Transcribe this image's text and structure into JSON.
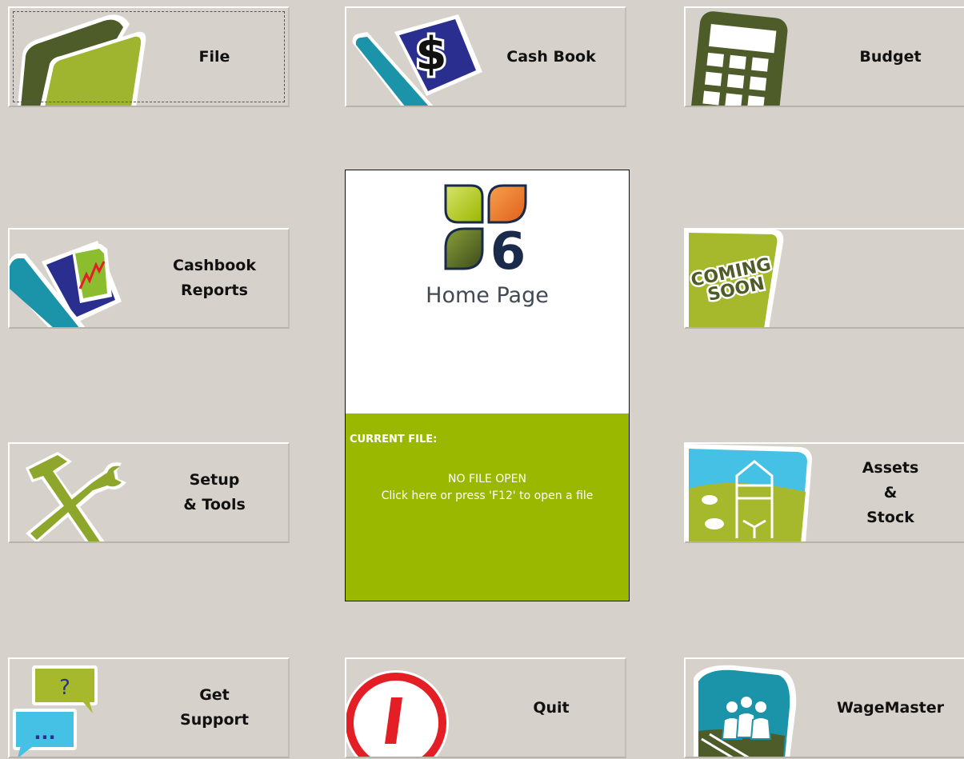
{
  "tiles": {
    "file": {
      "label": "File"
    },
    "cash_book": {
      "label": "Cash Book"
    },
    "budget": {
      "label": "Budget"
    },
    "cashbook_reports": {
      "label": "Cashbook\nReports"
    },
    "coming_soon": {
      "label": "",
      "badge_line1": "COMING",
      "badge_line2": "SOON"
    },
    "setup_tools": {
      "label": "Setup\n& Tools"
    },
    "assets_stock": {
      "label": "Assets\n&\nStock"
    },
    "get_support": {
      "label": "Get\nSupport"
    },
    "quit": {
      "label": "Quit"
    },
    "wagemaster": {
      "label": "WageMaster"
    }
  },
  "home_panel": {
    "logo_digit": "6",
    "title": "Home Page",
    "current_file_label": "CURRENT FILE:",
    "status_line1": "NO FILE OPEN",
    "status_line2": "Click here or press 'F12' to open a file"
  },
  "icons": {
    "file": "folder-icon",
    "cash_book": "cash-book-dollar-icon",
    "budget": "calculator-icon",
    "cashbook_reports": "report-chart-icon",
    "coming_soon": "coming-soon-icon",
    "setup_tools": "hammer-wrench-icon",
    "assets_stock": "farm-silo-icon",
    "get_support": "chat-bubbles-icon",
    "quit": "power-icon",
    "wagemaster": "staff-group-icon"
  },
  "colors": {
    "background": "#d6d2cb",
    "accent_green": "#9ab800",
    "dark_olive": "#4b5a2a",
    "teal": "#1ba3ba",
    "navy": "#2a2f8f",
    "quit_red": "#e31e24"
  }
}
